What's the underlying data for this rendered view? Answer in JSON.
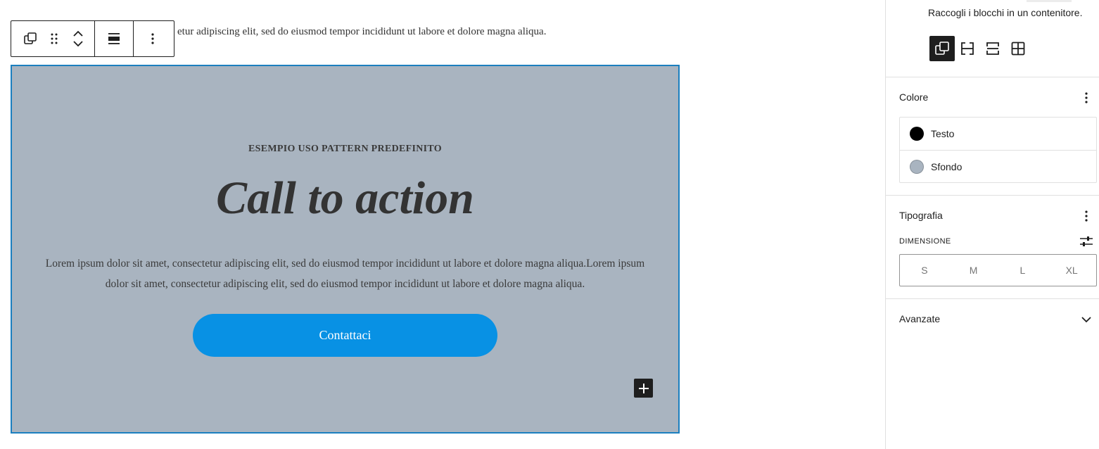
{
  "editor": {
    "intro_text": "etur adipiscing elit, sed do eiusmod tempor incididunt ut labore et dolore magna aliqua."
  },
  "toolbar": {
    "icons": [
      "group-icon",
      "drag-handle-icon",
      "move-up-icon",
      "move-down-icon",
      "align-icon",
      "more-options-icon"
    ]
  },
  "cover": {
    "background_color": "#a9b4c0",
    "kicker": "ESEMPIO USO PATTERN PREDEFINITO",
    "headline": "Call to action",
    "body": "Lorem ipsum dolor sit amet, consectetur adipiscing elit, sed do eiusmod tempor incididunt ut labore et dolore magna aliqua.Lorem ipsum dolor sit amet, consectetur adipiscing elit, sed do eiusmod tempor incididunt ut labore et dolore magna aliqua.",
    "button_label": "Contattaci",
    "button_color": "#0891e4"
  },
  "sidebar": {
    "description": "Raccogli i blocchi in un contenitore.",
    "variants": [
      {
        "icon": "group-icon",
        "active": true
      },
      {
        "icon": "row-icon",
        "active": false
      },
      {
        "icon": "stack-icon",
        "active": false
      },
      {
        "icon": "grid-icon",
        "active": false
      }
    ],
    "color": {
      "title": "Colore",
      "items": [
        {
          "label": "Testo",
          "swatch": "#000000"
        },
        {
          "label": "Sfondo",
          "swatch": "#a9b4c0"
        }
      ]
    },
    "typography": {
      "title": "Tipografia",
      "size_label": "DIMENSIONE",
      "sizes": [
        "S",
        "M",
        "L",
        "XL"
      ]
    },
    "advanced": {
      "title": "Avanzate"
    }
  }
}
